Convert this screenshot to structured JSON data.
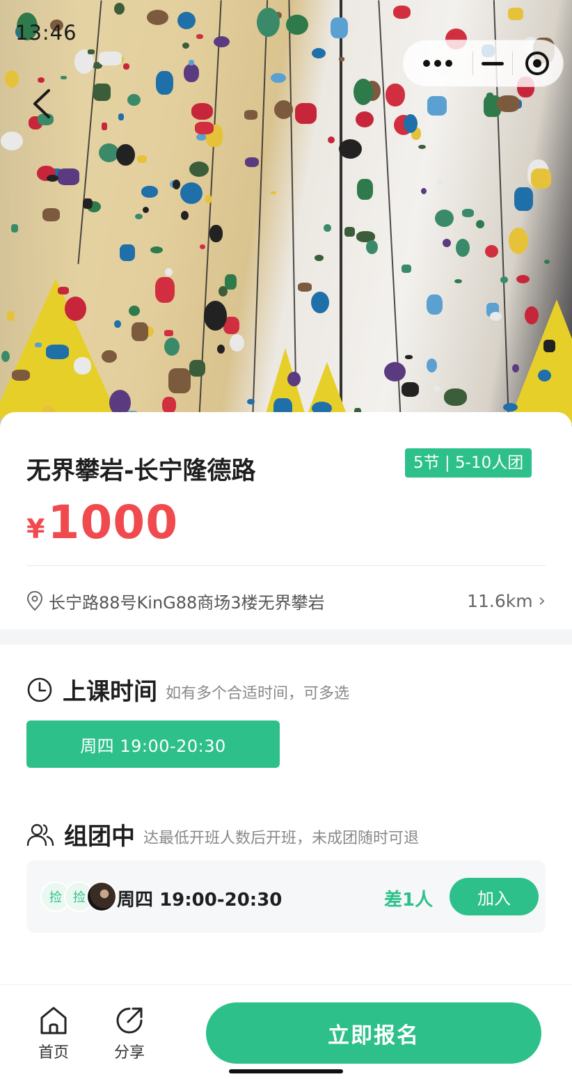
{
  "status_bar": {
    "time": "13:46"
  },
  "nav": {
    "back_icon": "chevron-left-icon",
    "capsule": {
      "more_icon": "more-dots-icon",
      "minimize_icon": "minimize-icon",
      "close_icon": "target-circle-icon"
    }
  },
  "course": {
    "title": "无界攀岩-长宁隆德路",
    "tag": "5节 | 5-10人团",
    "price_symbol": "¥",
    "price": "1000",
    "address": "长宁路88号KinG88商场3楼无界攀岩",
    "distance": "11.6km",
    "distance_arrow": "›"
  },
  "schedule": {
    "title": "上课时间",
    "subtitle": "如有多个合适时间，可多选",
    "slots": [
      {
        "label": "周四 19:00-20:30",
        "selected": true
      }
    ]
  },
  "group": {
    "title": "组团中",
    "subtitle": "达最低开班人数后开班，未成团随时可退",
    "items": [
      {
        "avatar_1": "捡",
        "avatar_2": "捡",
        "weekday": "周四",
        "time": "19:00-20:30",
        "need": "差1人",
        "join_label": "加入"
      }
    ]
  },
  "bottom_bar": {
    "home_label": "首页",
    "share_label": "分享",
    "signup_label": "立即报名"
  },
  "colors": {
    "accent": "#2dc08a",
    "price": "#f04a4e",
    "background_band": "#f4f5f7"
  }
}
